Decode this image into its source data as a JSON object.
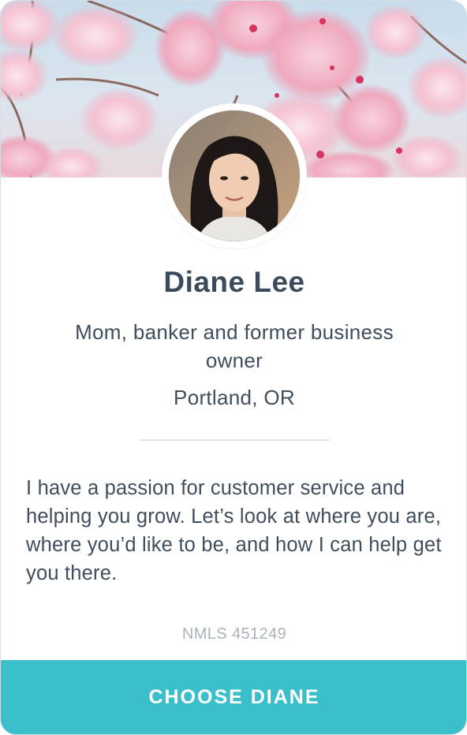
{
  "profile": {
    "name": "Diane Lee",
    "tagline": "Mom, banker and former business owner",
    "location": "Portland, OR",
    "bio": "I have a passion for customer service and helping you grow. Let’s look at where you are, where you’d like to be, and how I can help get you there.",
    "nmls": "NMLS 451249"
  },
  "actions": {
    "choose_label": "CHOOSE DIANE"
  },
  "colors": {
    "accent": "#3bc0cb",
    "text": "#3f4d5c",
    "muted": "#aab3bd"
  }
}
